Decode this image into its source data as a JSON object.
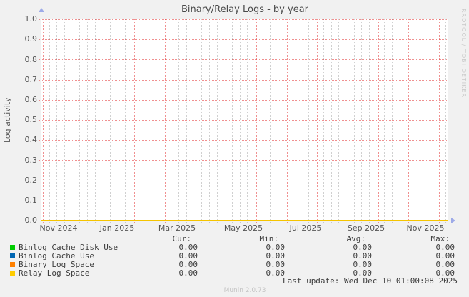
{
  "header": {
    "title": "Binary/Relay Logs - by year"
  },
  "watermark": "RRDTOOL / TOBI OETIKER",
  "y_axis": {
    "label": "Log activity",
    "ticks": [
      "1.0",
      "0.9",
      "0.8",
      "0.7",
      "0.6",
      "0.5",
      "0.4",
      "0.3",
      "0.2",
      "0.1",
      "0.0"
    ]
  },
  "x_axis": {
    "ticks": [
      "Nov 2024",
      "Jan 2025",
      "Mar 2025",
      "May 2025",
      "Jul 2025",
      "Sep 2025",
      "Nov 2025"
    ]
  },
  "chart_data": {
    "type": "line",
    "title": "Binary/Relay Logs - by year",
    "xlabel": "",
    "ylabel": "Log activity",
    "ylim": [
      0.0,
      1.0
    ],
    "y_tick_step": 0.1,
    "grid": "on",
    "legend_position": "bottom",
    "categories": [
      "Nov 2024",
      "Jan 2025",
      "Mar 2025",
      "May 2025",
      "Jul 2025",
      "Sep 2025",
      "Nov 2025"
    ],
    "series": [
      {
        "name": "Binlog Cache Disk Use",
        "color": "#00cc00",
        "values": [
          0,
          0,
          0,
          0,
          0,
          0,
          0
        ]
      },
      {
        "name": "Binlog Cache Use",
        "color": "#0066b3",
        "values": [
          0,
          0,
          0,
          0,
          0,
          0,
          0
        ]
      },
      {
        "name": "Binary Log Space",
        "color": "#ff8000",
        "values": [
          0,
          0,
          0,
          0,
          0,
          0,
          0
        ]
      },
      {
        "name": "Relay Log Space",
        "color": "#ffcc00",
        "values": [
          0,
          0,
          0,
          0,
          0,
          0,
          0
        ]
      }
    ]
  },
  "legend": {
    "headers": {
      "cur": "Cur:",
      "min": "Min:",
      "avg": "Avg:",
      "max": "Max:"
    },
    "rows": [
      {
        "label": "Binlog Cache Disk Use",
        "color": "#00cc00",
        "cur": "0.00",
        "min": "0.00",
        "avg": "0.00",
        "max": "0.00"
      },
      {
        "label": "Binlog Cache Use",
        "color": "#0066b3",
        "cur": "0.00",
        "min": "0.00",
        "avg": "0.00",
        "max": "0.00"
      },
      {
        "label": "Binary Log Space",
        "color": "#ff8000",
        "cur": "0.00",
        "min": "0.00",
        "avg": "0.00",
        "max": "0.00"
      },
      {
        "label": "Relay Log Space",
        "color": "#ffcc00",
        "cur": "0.00",
        "min": "0.00",
        "avg": "0.00",
        "max": "0.00"
      }
    ]
  },
  "footer": {
    "last_update": "Last update: Wed Dec 10 01:00:08 2025",
    "version": "Munin 2.0.73"
  }
}
